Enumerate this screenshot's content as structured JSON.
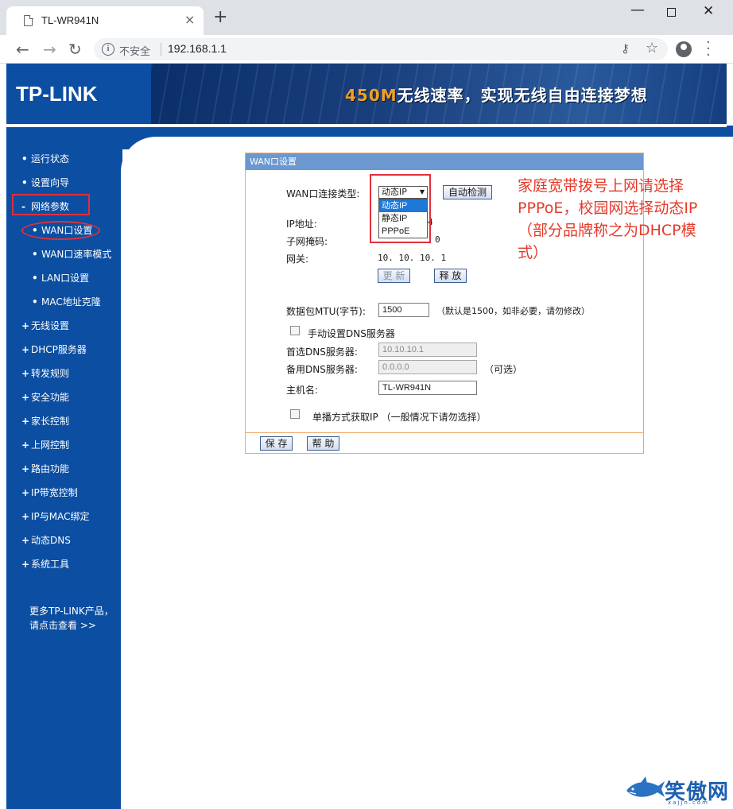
{
  "browser": {
    "tab_title": "TL-WR941N",
    "tab_close": "×",
    "new_tab": "+",
    "security_text": "不安全",
    "url": "192.168.1.1"
  },
  "banner": {
    "logo": "TP-LINK",
    "slogan_speed": "450M",
    "slogan_rest": "无线速率，实现无线自由连接梦想"
  },
  "sidebar": {
    "items": [
      {
        "bullet": "•",
        "label": "运行状态"
      },
      {
        "bullet": "•",
        "label": "设置向导"
      },
      {
        "bullet": "-",
        "label": "网络参数"
      },
      {
        "bullet": "•",
        "label": "WAN口设置"
      },
      {
        "bullet": "•",
        "label": "WAN口速率模式"
      },
      {
        "bullet": "•",
        "label": "LAN口设置"
      },
      {
        "bullet": "•",
        "label": "MAC地址克隆"
      },
      {
        "bullet": "+",
        "label": "无线设置"
      },
      {
        "bullet": "+",
        "label": "DHCP服务器"
      },
      {
        "bullet": "+",
        "label": "转发规则"
      },
      {
        "bullet": "+",
        "label": "安全功能"
      },
      {
        "bullet": "+",
        "label": "家长控制"
      },
      {
        "bullet": "+",
        "label": "上网控制"
      },
      {
        "bullet": "+",
        "label": "路由功能"
      },
      {
        "bullet": "+",
        "label": "IP带宽控制"
      },
      {
        "bullet": "+",
        "label": "IP与MAC绑定"
      },
      {
        "bullet": "+",
        "label": "动态DNS"
      },
      {
        "bullet": "+",
        "label": "系统工具"
      }
    ],
    "more_line1": "更多TP-LINK产品，",
    "more_line2": "请点击查看 >>"
  },
  "wan": {
    "title": "WAN口设置",
    "conn_type_label": "WAN口连接类型:",
    "conn_type_value": "动态IP",
    "auto_detect": "自动检测",
    "options": [
      "动态IP",
      "静态IP",
      "PPPoE"
    ],
    "ip_label": "IP地址:",
    "ip_value_tail": "4",
    "mask_label": "子网掩码:",
    "mask_value_tail": "0",
    "gateway_label": "网关:",
    "gateway_value": "10. 10. 10. 1",
    "renew": "更 新",
    "release": "释 放",
    "mtu_label": "数据包MTU(字节):",
    "mtu_value": "1500",
    "mtu_hint": "（默认是1500，如非必要，请勿修改）",
    "manual_dns_label": "手动设置DNS服务器",
    "dns1_label": "首选DNS服务器:",
    "dns1_value": "10.10.10.1",
    "dns2_label": "备用DNS服务器:",
    "dns2_value": "0.0.0.0",
    "dns2_hint": "（可选）",
    "hostname_label": "主机名:",
    "hostname_value": "TL-WR941N",
    "unicast_label": "单播方式获取IP （一般情况下请勿选择）",
    "save": "保 存",
    "help": "帮 助"
  },
  "annotation": "家庭宽带拨号上网请选择PPPoE，校园网选择动态IP（部分品牌称之为DHCP模式）",
  "watermark": {
    "text": "笑傲网",
    "sub": "xajjn.com"
  },
  "colors": {
    "router_blue": "#0b4ea2",
    "panel_title": "#6b98cf",
    "annotation_red": "#e53a2a",
    "selected_option": "#1e78d7"
  }
}
